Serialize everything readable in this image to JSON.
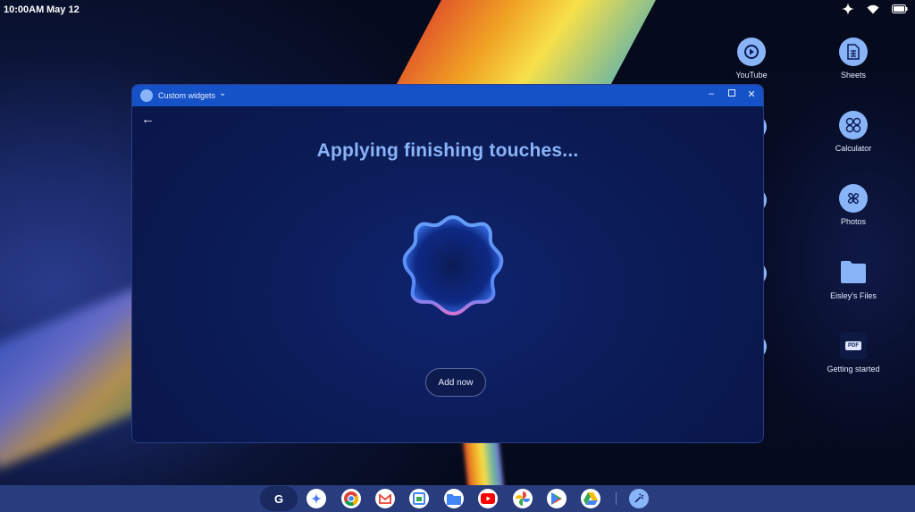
{
  "status_bar": {
    "time": "10:00AM",
    "date": "May 12"
  },
  "desktop": {
    "icons": [
      {
        "label": "YouTube",
        "icon": "youtube-icon"
      },
      {
        "label": "Sheets",
        "icon": "sheets-icon"
      },
      {
        "label": "Calculator",
        "icon": "calculator-icon"
      },
      {
        "label": "Photos",
        "icon": "photos-icon"
      },
      {
        "label": "Eisley's Files",
        "icon": "folder-icon"
      },
      {
        "label": "Getting started",
        "icon": "pdf-icon",
        "badge": "PDF"
      }
    ]
  },
  "window": {
    "title": "Custom widgets",
    "heading": "Applying finishing touches...",
    "add_button": "Add now"
  },
  "shelf": {
    "launcher_label": "G",
    "apps": [
      "gemini-icon",
      "chrome-icon",
      "gmail-icon",
      "calendar-icon",
      "files-icon",
      "youtube-icon",
      "photos-icon",
      "play-store-icon",
      "drive-icon",
      "assistant-icon"
    ]
  },
  "colors": {
    "accent": "#8ab4f8",
    "titlebar": "#1552c7",
    "window_bg": "#0d1f5c",
    "shelf": "#283c7e"
  }
}
